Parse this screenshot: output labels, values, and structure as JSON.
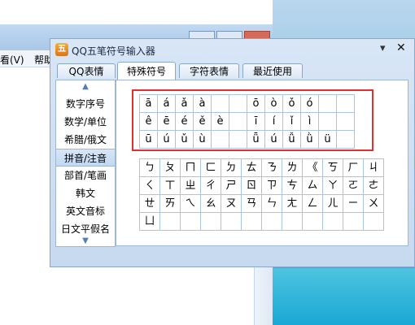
{
  "background_window": {
    "menu_items": [
      "看(V)",
      "帮助"
    ]
  },
  "dialog": {
    "title": "QQ五笔符号输入器",
    "icon": "五",
    "pin_icon": "pin-icon",
    "close_label": "✕"
  },
  "tabs": [
    {
      "label": "QQ表情",
      "active": false
    },
    {
      "label": "特殊符号",
      "active": true
    },
    {
      "label": "字符表情",
      "active": false
    },
    {
      "label": "最近使用",
      "active": false
    }
  ],
  "categories": [
    {
      "label": "数字序号",
      "selected": false
    },
    {
      "label": "数学/单位",
      "selected": false
    },
    {
      "label": "希腊/俄文",
      "selected": false
    },
    {
      "label": "拼音/注音",
      "selected": true
    },
    {
      "label": "部首/笔画",
      "selected": false
    },
    {
      "label": "韩文",
      "selected": false
    },
    {
      "label": "英文音标",
      "selected": false
    },
    {
      "label": "日文平假名",
      "selected": false
    }
  ],
  "pinyin_rows": [
    [
      "ā",
      "á",
      "ǎ",
      "à",
      "",
      "",
      "ō",
      "ò",
      "ǒ",
      "ó",
      "",
      ""
    ],
    [
      "ê",
      "ē",
      "é",
      "ě",
      "è",
      "",
      "ī",
      "í",
      "ǐ",
      "ì",
      "",
      ""
    ],
    [
      "ū",
      "ú",
      "ǔ",
      "ù",
      "",
      "",
      "ǖ",
      "ú",
      "ǚ",
      "ǜ",
      "ü",
      ""
    ]
  ],
  "zhuyin_rows": [
    [
      "ㄅ",
      "ㄆ",
      "ㄇ",
      "ㄈ",
      "ㄉ",
      "ㄊ",
      "ㄋ",
      "ㄌ",
      "《",
      "ㄎ",
      "ㄏ",
      "ㄐ"
    ],
    [
      "ㄑ",
      "ㄒ",
      "ㄓ",
      "ㄔ",
      "ㄕ",
      "ㄖ",
      "ㄗ",
      "ㄘ",
      "ㄙ",
      "ㄚ",
      "ㄛ",
      "ㄜ"
    ],
    [
      "ㄝ",
      "ㄞ",
      "ㄟ",
      "ㄠ",
      "ㄡ",
      "ㄢ",
      "ㄣ",
      "ㄤ",
      "ㄥ",
      "ㄦ",
      "ㄧ",
      "ㄨ"
    ],
    [
      "ㄩ",
      "",
      "",
      "",
      "",
      "",
      "",
      "",
      "",
      "",
      "",
      ""
    ]
  ],
  "colors": {
    "highlight_box": "#e03030",
    "grid_lines": "#a9c4e2"
  }
}
